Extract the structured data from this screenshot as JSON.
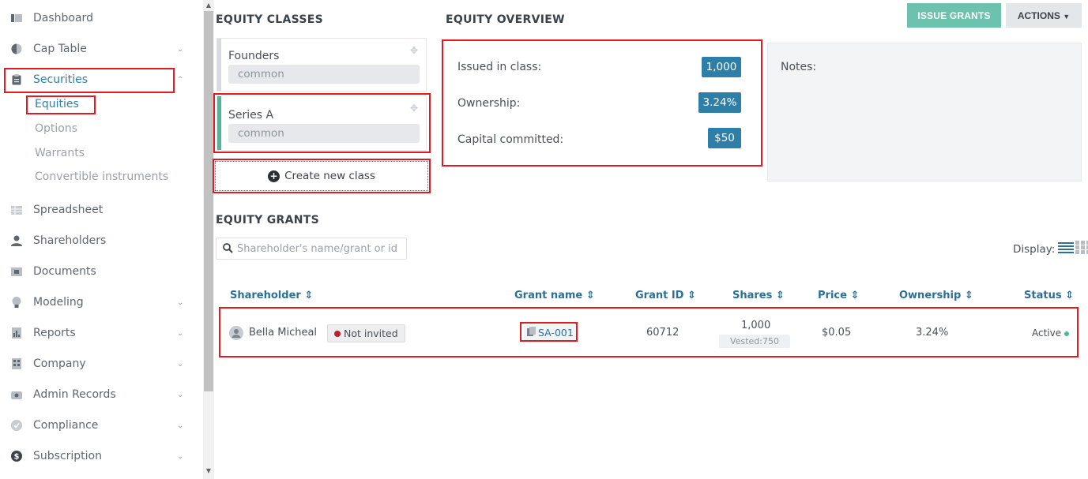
{
  "sidebar": {
    "items": [
      {
        "label": "Dashboard",
        "icon": "dashboard-icon"
      },
      {
        "label": "Cap Table",
        "icon": "pie-chart-icon"
      },
      {
        "label": "Securities",
        "icon": "clipboard-icon"
      },
      {
        "label": "Spreadsheet",
        "icon": "spreadsheet-icon"
      },
      {
        "label": "Shareholders",
        "icon": "user-icon"
      },
      {
        "label": "Documents",
        "icon": "folder-icon"
      },
      {
        "label": "Modeling",
        "icon": "lightbulb-icon"
      },
      {
        "label": "Reports",
        "icon": "reports-icon"
      },
      {
        "label": "Company",
        "icon": "building-icon"
      },
      {
        "label": "Admin Records",
        "icon": "admin-records-icon"
      },
      {
        "label": "Compliance",
        "icon": "shield-check-icon"
      },
      {
        "label": "Subscription",
        "icon": "dollar-circle-icon"
      }
    ],
    "securities_sub": [
      "Equities",
      "Options",
      "Warrants",
      "Convertible instruments"
    ]
  },
  "equity_classes": {
    "title": "EQUITY CLASSES",
    "classes": [
      {
        "name": "Founders",
        "type": "common"
      },
      {
        "name": "Series A",
        "type": "common"
      }
    ],
    "create_label": "Create new class"
  },
  "overview": {
    "title": "EQUITY OVERVIEW",
    "issued_label": "Issued in class:",
    "issued_value": "1,000",
    "ownership_label": "Ownership:",
    "ownership_value": "3.24%",
    "capital_label": "Capital committed:",
    "capital_value": "$50",
    "notes_label": "Notes:"
  },
  "toolbar": {
    "issue_label": "ISSUE GRANTS",
    "actions_label": "ACTIONS"
  },
  "grants": {
    "title": "EQUITY GRANTS",
    "search_placeholder": "Shareholder's name/grant or id",
    "display_label": "Display:",
    "columns": {
      "shareholder": "Shareholder",
      "grant_name": "Grant name",
      "grant_id": "Grant ID",
      "shares": "Shares",
      "price": "Price",
      "ownership": "Ownership",
      "status": "Status"
    },
    "rows": [
      {
        "shareholder": "Bella Micheal",
        "invite_status": "Not invited",
        "grant_name": "SA-001",
        "grant_id": "60712",
        "shares": "1,000",
        "vested": "Vested:750",
        "price": "$0.05",
        "ownership": "3.24%",
        "status": "Active"
      }
    ]
  },
  "colors": {
    "accent": "#2e7fa8",
    "issue_button": "#6dc2ad",
    "selected_bar": "#4db897",
    "highlight": "#e01b24"
  }
}
